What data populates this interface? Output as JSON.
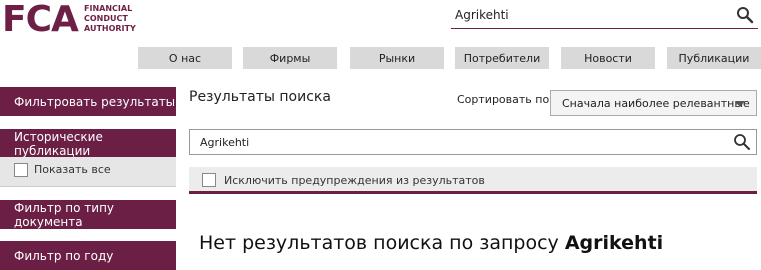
{
  "logo": {
    "letters": "FCA",
    "line1": "FINANCIAL",
    "line2": "CONDUCT",
    "line3": "AUTHORITY"
  },
  "header_search": {
    "value": "Agrikehti",
    "icon": "search-icon"
  },
  "nav": {
    "items": [
      "О нас",
      "Фирмы",
      "Рынки",
      "Потребители",
      "Новости",
      "Публикации"
    ]
  },
  "sidebar": {
    "filter_results": "Фильтровать результаты",
    "historical": "Исторические публикации",
    "show_all": "Показать все",
    "doc_type": "Фильтр по типу документа",
    "year": "Фильтр по году"
  },
  "main": {
    "results_title": "Результаты поиска",
    "sort_label": "Сортировать по:",
    "sort_value": "Сначала наиболее релевантные",
    "search_value": "Agrikehti",
    "exclude_label": "Исключить предупреждения из результатов",
    "no_results_prefix": "Нет результатов поиска по запросу",
    "no_results_query": "Agrikehti"
  },
  "colors": {
    "brand": "#6b1f45",
    "nav_bg": "#d9d9d9"
  }
}
